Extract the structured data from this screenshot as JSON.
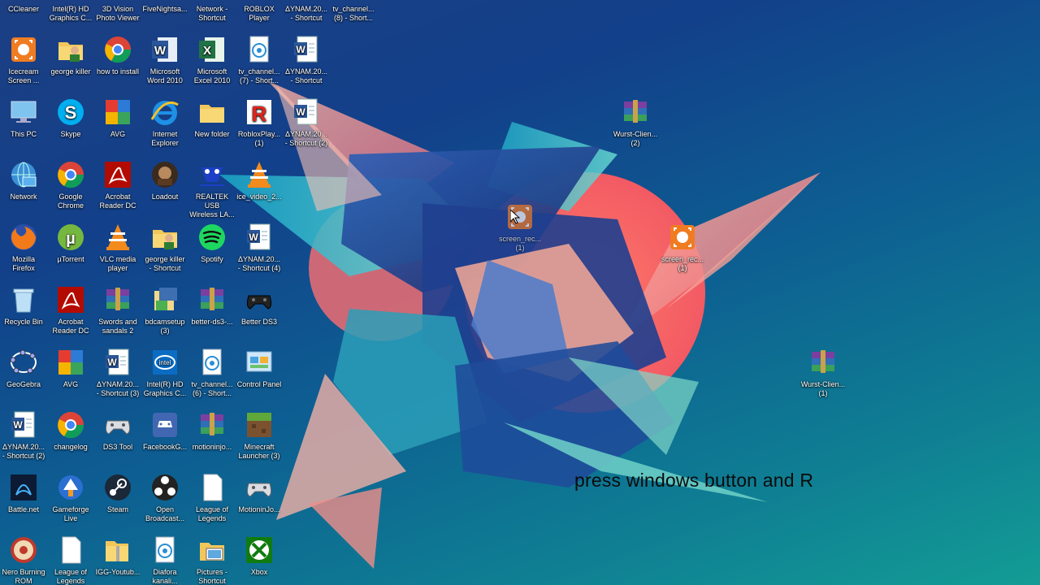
{
  "overlay_text": "press windows button and R",
  "icons": [
    {
      "id": "ccleaner",
      "label": "CCleaner",
      "type": "ccleaner",
      "col": 0,
      "row": -1
    },
    {
      "id": "intel-hd-top",
      "label": "Intel(R) HD\nGraphics C...",
      "type": "intel",
      "col": 1,
      "row": -1
    },
    {
      "id": "3d-vision",
      "label": "3D Vision\nPhoto Viewer",
      "type": "nvidia",
      "col": 2,
      "row": -1
    },
    {
      "id": "fivenights",
      "label": "FiveNightsa...",
      "type": "game",
      "col": 3,
      "row": -1
    },
    {
      "id": "network-shortcut",
      "label": "Network -\nShortcut",
      "type": "network",
      "col": 4,
      "row": -1
    },
    {
      "id": "roblox-player",
      "label": "ROBLOX\nPlayer",
      "type": "roblox",
      "col": 5,
      "row": -1
    },
    {
      "id": "dynam-top",
      "label": "ΔYNAM.20...\n- Shortcut",
      "type": "word",
      "col": 6,
      "row": -1
    },
    {
      "id": "tv-channel-8",
      "label": "tv_channel...\n(8) - Short...",
      "type": "media",
      "col": 7,
      "row": -1
    },
    {
      "id": "icecream",
      "label": "Icecream\nScreen ...",
      "type": "icecream",
      "col": 0,
      "row": 0
    },
    {
      "id": "george-killer",
      "label": "george killer",
      "type": "user-folder",
      "col": 1,
      "row": 0
    },
    {
      "id": "how-to-install",
      "label": "how to install",
      "type": "chrome",
      "col": 2,
      "row": 0
    },
    {
      "id": "word-2010",
      "label": "Microsoft\nWord 2010",
      "type": "word-app",
      "col": 3,
      "row": 0
    },
    {
      "id": "excel-2010",
      "label": "Microsoft\nExcel 2010",
      "type": "excel",
      "col": 4,
      "row": 0
    },
    {
      "id": "tv-channel-7",
      "label": "tv_channel...\n(7) - Short...",
      "type": "media",
      "col": 5,
      "row": 0
    },
    {
      "id": "dynam-1",
      "label": "ΔYNAM.20...\n- Shortcut",
      "type": "word",
      "col": 6,
      "row": 0
    },
    {
      "id": "this-pc",
      "label": "This PC",
      "type": "pc",
      "col": 0,
      "row": 1
    },
    {
      "id": "skype",
      "label": "Skype",
      "type": "skype",
      "col": 1,
      "row": 1
    },
    {
      "id": "avg-1",
      "label": "AVG",
      "type": "avg",
      "col": 2,
      "row": 1
    },
    {
      "id": "ie",
      "label": "Internet\nExplorer",
      "type": "ie",
      "col": 3,
      "row": 1
    },
    {
      "id": "new-folder",
      "label": "New folder",
      "type": "folder",
      "col": 4,
      "row": 1
    },
    {
      "id": "roblox-play",
      "label": "RobloxPlay...\n(1)",
      "type": "roblox",
      "col": 5,
      "row": 1
    },
    {
      "id": "dynam-2",
      "label": "ΔYNAM.20...\n- Shortcut (2)",
      "type": "word",
      "col": 6,
      "row": 1
    },
    {
      "id": "network",
      "label": "Network",
      "type": "network",
      "col": 0,
      "row": 2
    },
    {
      "id": "google-chrome",
      "label": "Google\nChrome",
      "type": "chrome",
      "col": 1,
      "row": 2
    },
    {
      "id": "acrobat-1",
      "label": "Acrobat\nReader DC",
      "type": "acrobat",
      "col": 2,
      "row": 2
    },
    {
      "id": "loadout",
      "label": "Loadout",
      "type": "loadout",
      "col": 3,
      "row": 2
    },
    {
      "id": "realtek",
      "label": "REALTEK USB\nWireless LA...",
      "type": "realtek",
      "col": 4,
      "row": 2
    },
    {
      "id": "ice-video",
      "label": "ice_video_2...",
      "type": "vlc",
      "col": 5,
      "row": 2
    },
    {
      "id": "firefox",
      "label": "Mozilla\nFirefox",
      "type": "firefox",
      "col": 0,
      "row": 3
    },
    {
      "id": "utorrent",
      "label": "µTorrent",
      "type": "utorrent",
      "col": 1,
      "row": 3
    },
    {
      "id": "vlc",
      "label": "VLC media\nplayer",
      "type": "vlc",
      "col": 2,
      "row": 3
    },
    {
      "id": "george-killer-sc",
      "label": "george killer\n- Shortcut",
      "type": "user-folder",
      "col": 3,
      "row": 3
    },
    {
      "id": "spotify",
      "label": "Spotify",
      "type": "spotify",
      "col": 4,
      "row": 3
    },
    {
      "id": "dynam-4",
      "label": "ΔYNAM.20...\n- Shortcut (4)",
      "type": "word",
      "col": 5,
      "row": 3
    },
    {
      "id": "recycle-bin",
      "label": "Recycle Bin",
      "type": "recycle",
      "col": 0,
      "row": 4
    },
    {
      "id": "acrobat-2",
      "label": "Acrobat\nReader DC",
      "type": "acrobat",
      "col": 1,
      "row": 4
    },
    {
      "id": "swords",
      "label": "Swords and\nsandals 2",
      "type": "winrar",
      "col": 2,
      "row": 4
    },
    {
      "id": "bdcamsetup",
      "label": "bdcamsetup\n(3)",
      "type": "installer",
      "col": 3,
      "row": 4
    },
    {
      "id": "better-ds3-zip",
      "label": "better-ds3-...",
      "type": "winrar",
      "col": 4,
      "row": 4
    },
    {
      "id": "better-ds3",
      "label": "Better DS3",
      "type": "gamepad-dark",
      "col": 5,
      "row": 4
    },
    {
      "id": "geogebra",
      "label": "GeoGebra",
      "type": "geogebra",
      "col": 0,
      "row": 5
    },
    {
      "id": "avg-2",
      "label": "AVG",
      "type": "avg",
      "col": 1,
      "row": 5
    },
    {
      "id": "dynam-3",
      "label": "ΔYNAM.20...\n- Shortcut (3)",
      "type": "word",
      "col": 2,
      "row": 5
    },
    {
      "id": "intel-hd",
      "label": "Intel(R) HD\nGraphics C...",
      "type": "intel",
      "col": 3,
      "row": 5
    },
    {
      "id": "tv-channel-6",
      "label": "tv_channel...\n(6) - Short...",
      "type": "media",
      "col": 4,
      "row": 5
    },
    {
      "id": "control-panel",
      "label": "Control Panel",
      "type": "control-panel",
      "col": 5,
      "row": 5
    },
    {
      "id": "dynam-2b",
      "label": "ΔYNAM.20...\n- Shortcut (2)",
      "type": "word",
      "col": 0,
      "row": 6
    },
    {
      "id": "changelog",
      "label": "changelog",
      "type": "chrome",
      "col": 1,
      "row": 6
    },
    {
      "id": "ds3-tool",
      "label": "DS3 Tool",
      "type": "gamepad",
      "col": 2,
      "row": 6
    },
    {
      "id": "facebook-gameroom",
      "label": "FacebookG...",
      "type": "fb-game",
      "col": 3,
      "row": 6
    },
    {
      "id": "motioninjoy-zip",
      "label": "motioninjo...",
      "type": "winrar",
      "col": 4,
      "row": 6
    },
    {
      "id": "minecraft",
      "label": "Minecraft\nLauncher (3)",
      "type": "minecraft",
      "col": 5,
      "row": 6
    },
    {
      "id": "battle-net",
      "label": "Battle.net",
      "type": "battlenet",
      "col": 0,
      "row": 7
    },
    {
      "id": "gameforge",
      "label": "Gameforge\nLive",
      "type": "gameforge",
      "col": 1,
      "row": 7
    },
    {
      "id": "steam",
      "label": "Steam",
      "type": "steam",
      "col": 2,
      "row": 7
    },
    {
      "id": "obs",
      "label": "Open\nBroadcast...",
      "type": "obs",
      "col": 3,
      "row": 7
    },
    {
      "id": "league-1",
      "label": "League of\nLegends",
      "type": "blank",
      "col": 4,
      "row": 7
    },
    {
      "id": "motioninjoy",
      "label": "MotioninJo...",
      "type": "gamepad",
      "col": 5,
      "row": 7
    },
    {
      "id": "nero",
      "label": "Nero Burning\nROM",
      "type": "nero",
      "col": 0,
      "row": 8
    },
    {
      "id": "league-2",
      "label": "League of\nLegends",
      "type": "blank",
      "col": 1,
      "row": 8
    },
    {
      "id": "igg-youtube",
      "label": "IGG-Youtub...",
      "type": "zip-folder",
      "col": 2,
      "row": 8
    },
    {
      "id": "diafora",
      "label": "Diafora\nkanali...",
      "type": "media",
      "col": 3,
      "row": 8
    },
    {
      "id": "pictures",
      "label": "Pictures -\nShortcut",
      "type": "pictures",
      "col": 4,
      "row": 8
    },
    {
      "id": "xbox",
      "label": "Xbox",
      "type": "xbox",
      "col": 5,
      "row": 8
    }
  ],
  "free_icons": [
    {
      "id": "wurst-2",
      "label": "Wurst-Clien...\n(2)",
      "type": "winrar",
      "slot": "a"
    },
    {
      "id": "screen-rec-drag",
      "label": "screen_rec...\n(1)",
      "type": "icecream",
      "slot": "b",
      "faded": true
    },
    {
      "id": "screen-rec-1",
      "label": "screen_rec...\n(1)",
      "type": "icecream",
      "slot": "c"
    },
    {
      "id": "wurst-1",
      "label": "Wurst-Clien...\n(1)",
      "type": "winrar",
      "slot": "d"
    }
  ]
}
